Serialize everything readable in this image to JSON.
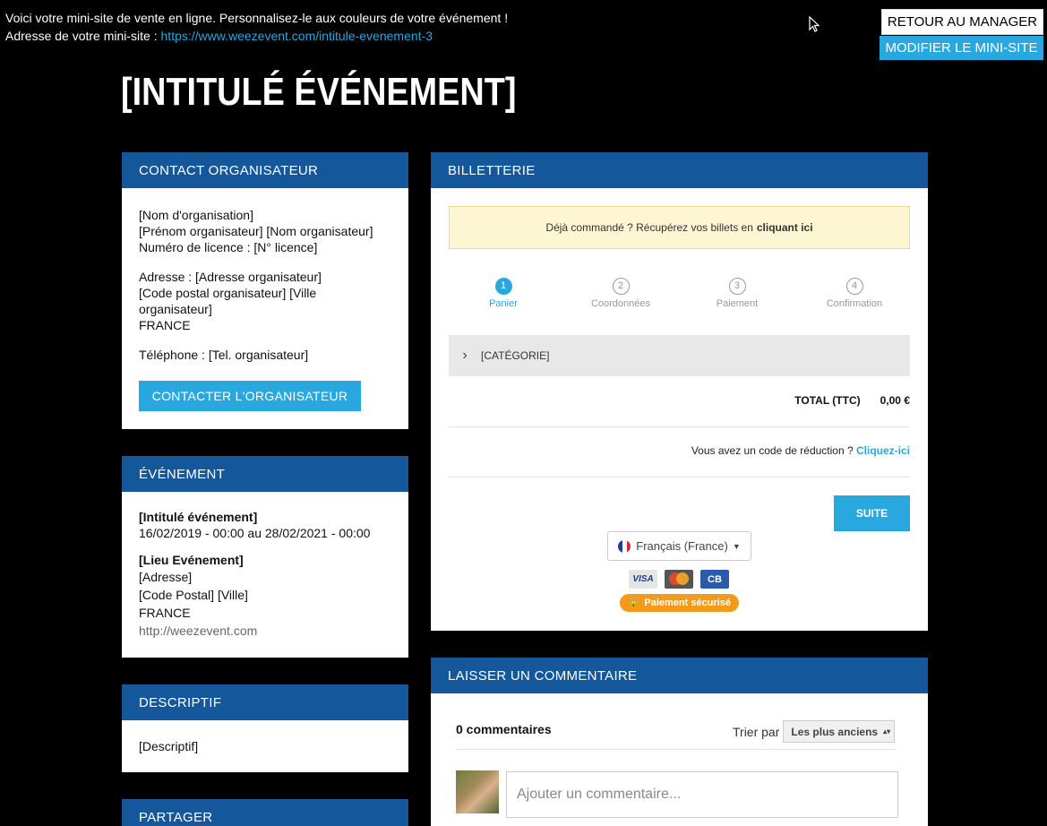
{
  "topbar": {
    "line1": "Voici votre mini-site de vente en ligne. Personnalisez-le aux couleurs de votre événement !",
    "line2_prefix": "Adresse de votre mini-site : ",
    "url": "https://www.weezevent.com/intitule-evenement-3",
    "retour_label": "RETOUR AU MANAGER",
    "modifier_label": "MODIFIER LE MINI-SITE"
  },
  "page": {
    "title": "[INTITULÉ ÉVÉNEMENT]"
  },
  "contact": {
    "heading": "CONTACT ORGANISATEUR",
    "lines_a": [
      "[Nom d'organisation]",
      "[Prénom organisateur] [Nom organisateur]",
      "Numéro de licence : [N° licence]"
    ],
    "lines_b": [
      "Adresse : [Adresse organisateur]",
      "[Code postal organisateur] [Ville organisateur]",
      "FRANCE"
    ],
    "phone": "Téléphone : [Tel. organisateur]",
    "button_label": "CONTACTER L'ORGANISATEUR"
  },
  "evenement": {
    "heading": "ÉVÉNEMENT",
    "name": "[Intitulé événement]",
    "dates": "16/02/2019 - 00:00 au 28/02/2021 - 00:00",
    "lieu": "[Lieu Evénement]",
    "adresse": "[Adresse]",
    "ville": "[Code Postal] [Ville]",
    "pays": "FRANCE",
    "url": "http://weezevent.com"
  },
  "descriptif": {
    "heading": "DESCRIPTIF",
    "text": "[Descriptif]"
  },
  "partager": {
    "heading": "PARTAGER"
  },
  "billetterie": {
    "heading": "BILLETTERIE",
    "notice_text": "Déjà commandé ? Récupérez vos billets en",
    "notice_link": "cliquant ici",
    "steps": [
      {
        "num": "1",
        "label": "Panier"
      },
      {
        "num": "2",
        "label": "Coordonnées"
      },
      {
        "num": "3",
        "label": "Paiement"
      },
      {
        "num": "4",
        "label": "Confirmation"
      }
    ],
    "categorie": "[CATÉGORIE]",
    "total_label": "TOTAL (TTC)",
    "total_value": "0,00 €",
    "reduc_text": "Vous avez un code de réduction ?",
    "reduc_link": "Cliquez-ici",
    "suite_label": "SUITE",
    "language": "Français (France)",
    "cards": [
      "VISA",
      "MasterCard",
      "CB"
    ],
    "secure_label": "Paiement sécurisé"
  },
  "commentaire": {
    "heading": "LAISSER UN COMMENTAIRE",
    "count": "0 commentaires",
    "sort_label": "Trier par",
    "sort_value": "Les plus anciens",
    "input_placeholder": "Ajouter un commentaire..."
  }
}
